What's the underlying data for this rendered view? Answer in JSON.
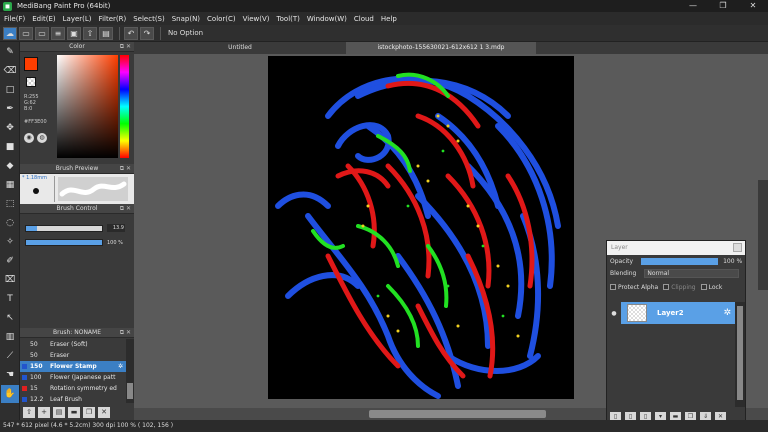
{
  "window": {
    "title": "MediBang Paint Pro (64bit)",
    "icon": "medibang-icon",
    "controls": {
      "minimize": "—",
      "maximize": "❐",
      "close": "✕"
    }
  },
  "menu": [
    "File(F)",
    "Edit(E)",
    "Layer(L)",
    "Filter(R)",
    "Select(S)",
    "Snap(N)",
    "Color(C)",
    "View(V)",
    "Tool(T)",
    "Window(W)",
    "Cloud",
    "Help"
  ],
  "toolbar": {
    "snap_label": "No Option"
  },
  "color_panel": {
    "title": "Color",
    "main_color": "#ff3e00",
    "rgb": [
      "R:255",
      "G:62",
      "B:0"
    ],
    "hex": "#FF3E00"
  },
  "brush_preview": {
    "title": "Brush Preview",
    "size": "1.18mm"
  },
  "brush_control": {
    "title": "Brush Control",
    "size_value": "13.9",
    "opacity_value": "100 %",
    "size_fraction": 0.15,
    "opacity_fraction": 1.0
  },
  "brush_list": {
    "title": "Brush: NONAME",
    "items": [
      {
        "num": "50",
        "name": "Eraser (Soft)",
        "color": "#3a3a3a",
        "selected": false
      },
      {
        "num": "50",
        "name": "Eraser",
        "color": "#3a3a3a",
        "selected": false
      },
      {
        "num": "150",
        "name": "Flower Stamp",
        "color": "#2255cc",
        "selected": true
      },
      {
        "num": "100",
        "name": "Flower (Japanese patt",
        "color": "#2255cc",
        "selected": false
      },
      {
        "num": "15",
        "name": "Rotation symmetry ed",
        "color": "#e02020",
        "selected": false
      },
      {
        "num": "12.2",
        "name": "Leaf Brush",
        "color": "#2255cc",
        "selected": false
      }
    ]
  },
  "tabs": {
    "untitled": "Untitled",
    "active": "istockphoto-155630021-612x612 1 3.mdp"
  },
  "layer_panel": {
    "title": "Layer",
    "opacity_label": "Opacity",
    "opacity_value": "100 %",
    "blending_label": "Blending",
    "blending_value": "Normal",
    "protect_alpha": "Protect Alpha",
    "clipping": "Clipping",
    "lock": "Lock",
    "layers": [
      {
        "name": "Layer2",
        "visible": true
      }
    ]
  },
  "status": "547 * 612 pixel   (4.6 * 5.2cm)  300 dpi  100 %   ( 102, 156 )",
  "colors": {
    "accent": "#3b7fc4",
    "canvas_bg": "#000000",
    "stroke_blue": "#1f4fe0",
    "stroke_red": "#e01818",
    "stroke_green": "#22e022"
  }
}
